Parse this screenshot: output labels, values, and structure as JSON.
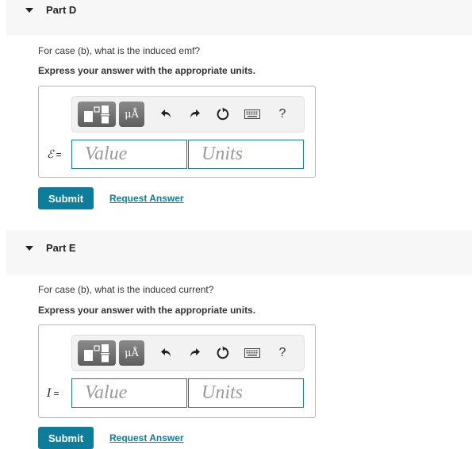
{
  "parts": [
    {
      "title": "Part D",
      "question": "For case (b), what is the induced emf?",
      "instruction": "Express your answer with the appropriate units.",
      "variable": "ℰ",
      "equals": "=",
      "value_placeholder": "Value",
      "units_placeholder": "Units",
      "submit_label": "Submit",
      "request_label": "Request Answer"
    },
    {
      "title": "Part E",
      "question": "For case (b), what is the induced current?",
      "instruction": "Express your answer with the appropriate units.",
      "variable": "I",
      "equals": "=",
      "value_placeholder": "Value",
      "units_placeholder": "Units",
      "submit_label": "Submit",
      "request_label": "Request Answer"
    }
  ],
  "toolbar": {
    "units_label": "μÅ",
    "help_label": "?",
    "icons": [
      "templates-icon",
      "units-icon",
      "undo-icon",
      "redo-icon",
      "reset-icon",
      "keyboard-icon",
      "help-icon"
    ]
  },
  "colors": {
    "accent": "#0e7c9b",
    "input_border": "#1a7a8c",
    "header_bg": "#f7f7f7"
  }
}
